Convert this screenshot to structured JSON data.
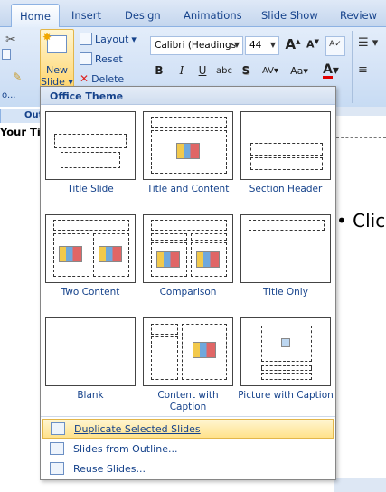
{
  "tabs": [
    "Home",
    "Insert",
    "Design",
    "Animations",
    "Slide Show",
    "Review"
  ],
  "ribbon": {
    "new_slide_line1": "New",
    "new_slide_line2": "Slide",
    "layout": "Layout",
    "reset": "Reset",
    "delete": "Delete",
    "font_name": "Calibri (Headings",
    "font_size": "44",
    "bold": "B",
    "italic": "I",
    "underline": "U",
    "strike": "abc",
    "shadow": "S",
    "spacing": "AV",
    "case": "Aa",
    "grow": "A",
    "shrink": "A",
    "font_color": "A",
    "clipboard_fragment": "o...",
    "left_partial_tab": "Out",
    "left_partial_text": "Your Tit"
  },
  "slide_text": "• Click",
  "menu": {
    "header": "Office Theme",
    "layouts": [
      {
        "label": "Title Slide"
      },
      {
        "label": "Title and Content"
      },
      {
        "label": "Section Header"
      },
      {
        "label": "Two Content"
      },
      {
        "label": "Comparison"
      },
      {
        "label": "Title Only"
      },
      {
        "label": "Blank"
      },
      {
        "label": "Content with Caption"
      },
      {
        "label": "Picture with Caption"
      }
    ],
    "items": [
      {
        "label": "Duplicate Selected Slides",
        "icon": "duplicate-slides-icon"
      },
      {
        "label": "Slides from Outline...",
        "icon": "outline-icon"
      },
      {
        "label": "Reuse Slides...",
        "icon": "reuse-slides-icon"
      }
    ]
  },
  "colors": {
    "accent": "#15428b",
    "highlight": "#ffe28a",
    "font_color_bar": "#e00000"
  }
}
